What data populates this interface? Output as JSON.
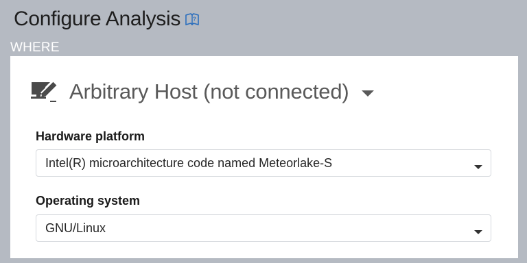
{
  "header": {
    "title": "Configure Analysis",
    "help_icon": "help-book-icon"
  },
  "where": {
    "section_label": "WHERE",
    "target": {
      "title": "Arbitrary Host (not connected)",
      "icon": "edit-host-icon",
      "caret_icon": "caret-down-icon"
    },
    "hardware_platform": {
      "label": "Hardware platform",
      "selected": "Intel(R) microarchitecture code named Meteorlake-S"
    },
    "operating_system": {
      "label": "Operating system",
      "selected": "GNU/Linux"
    }
  },
  "colors": {
    "background": "#b5bac2",
    "panel": "#ffffff",
    "help_icon": "#2a6ebd",
    "target_text": "#595959",
    "host_icon": "#4a4a4a"
  }
}
